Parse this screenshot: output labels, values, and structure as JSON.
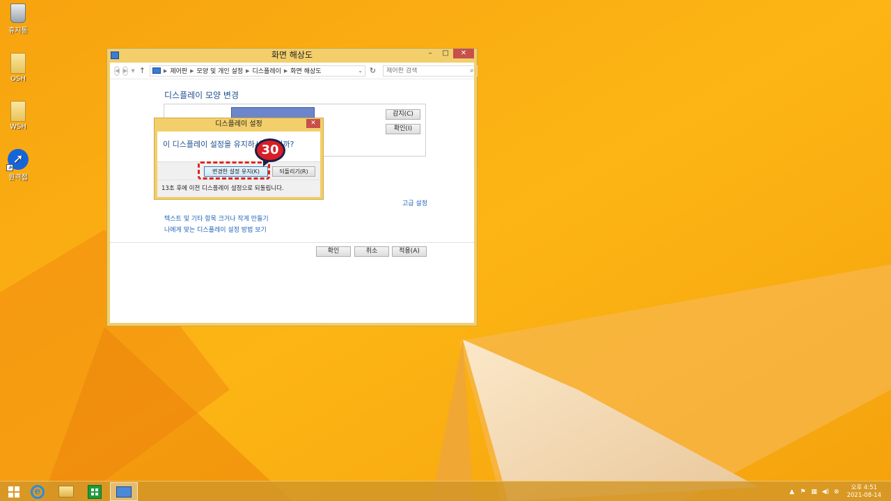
{
  "desktop": {
    "icons": [
      {
        "label": "휴지통",
        "icon": "recycle-bin-icon"
      },
      {
        "label": "OSH",
        "icon": "folder-icon"
      },
      {
        "label": "WSH",
        "icon": "folder-icon"
      },
      {
        "label": "원격접",
        "icon": "anydesk-icon"
      }
    ]
  },
  "window": {
    "title": "화면 해상도",
    "controls": {
      "minimize": "–",
      "maximize": "□",
      "close": "✕"
    },
    "addressbar": {
      "breadcrumbs": [
        "제어판",
        "모양 및 개인 설정",
        "디스플레이",
        "화면 해상도"
      ],
      "search_placeholder": "제어판 검색"
    },
    "heading": "디스플레이 모양 변경",
    "detect_button": "감지(C)",
    "identify_button": "확인(I)",
    "advanced_link": "고급 설정",
    "links": [
      "텍스트 및 기타 항목 크거나 작게 만들기",
      "나에게 맞는 디스플레이 설정 방법 보기"
    ],
    "buttons": {
      "ok": "확인",
      "cancel": "취소",
      "apply": "적용(A)"
    }
  },
  "dialog": {
    "title": "디스플레이 설정",
    "close": "✕",
    "question": "이 디스플레이 설정을 유지하시겠습니까?",
    "keep_button": "변경한 설정 유지(K)",
    "revert_button": "되돌리기(R)",
    "status": "13초 후에 이전 디스플레이 설정으로 되돌립니다."
  },
  "annotation": {
    "step_number": "30"
  },
  "taskbar": {
    "clock_time": "오후 4:51",
    "clock_date": "2021-08-14"
  },
  "colors": {
    "wallpaper": "#f4a712",
    "window_frame": "#f2cf6b",
    "link": "#1e63b8",
    "heading": "#1e4e8f",
    "annotation": "#e2241f"
  }
}
